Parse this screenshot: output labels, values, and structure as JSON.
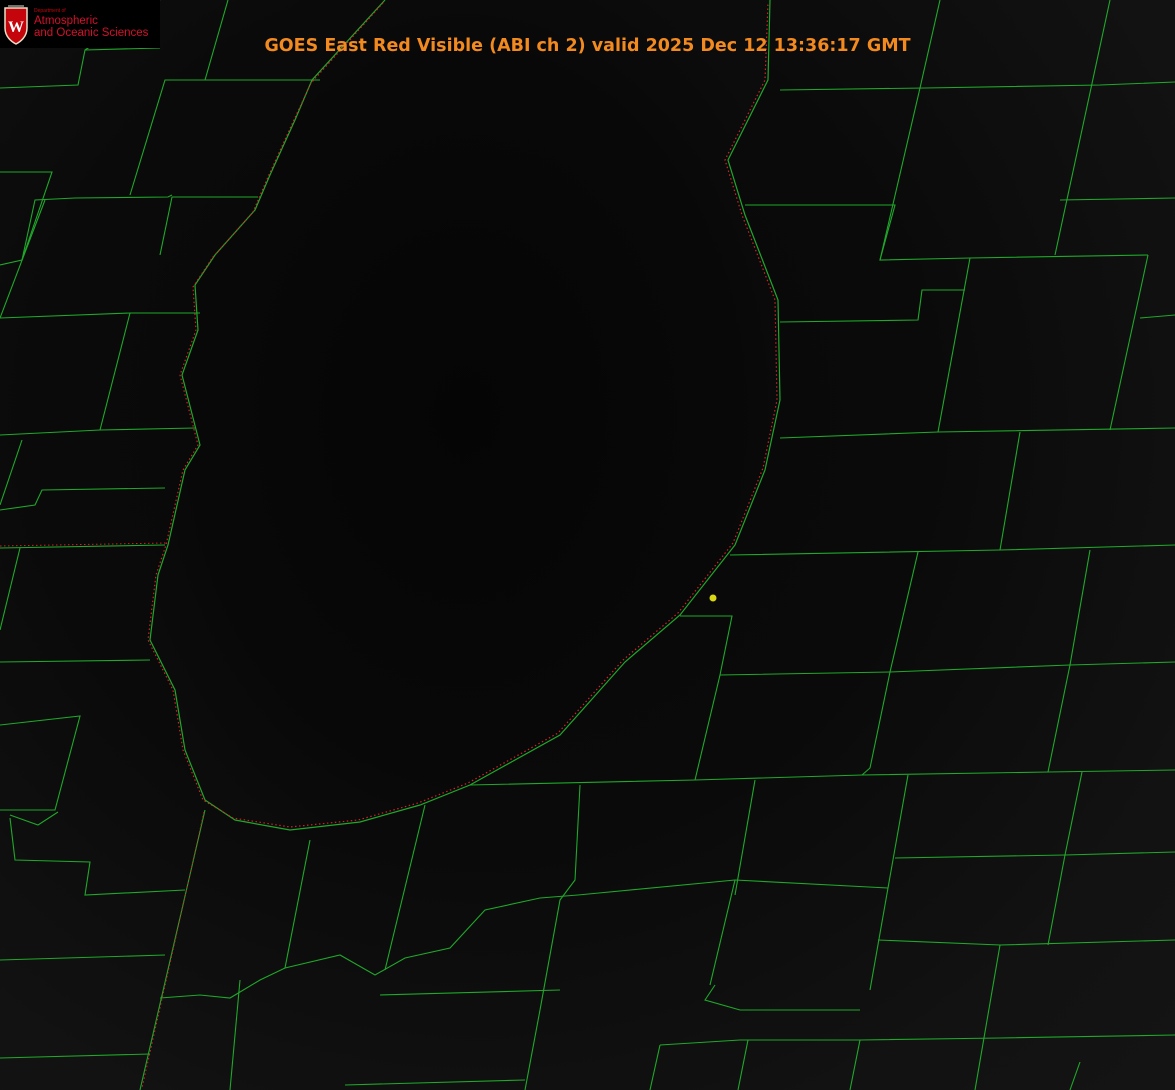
{
  "title": "GOES East Red Visible (ABI ch 2) valid 2025 Dec 12 13:36:17 GMT",
  "logo": {
    "department": "Department of",
    "line1": "Atmospheric",
    "line2": "and Oceanic Sciences",
    "shield_letter": "W"
  },
  "colors": {
    "title": "#f28a1f",
    "county_lines": "#1fa82a",
    "coastline_dotted": "#d2232a",
    "station_marker": "#d8d815",
    "logo_red": "#c5050c"
  },
  "icons": {
    "logo": "uw-shield-icon",
    "station": "station-dot-icon"
  }
}
